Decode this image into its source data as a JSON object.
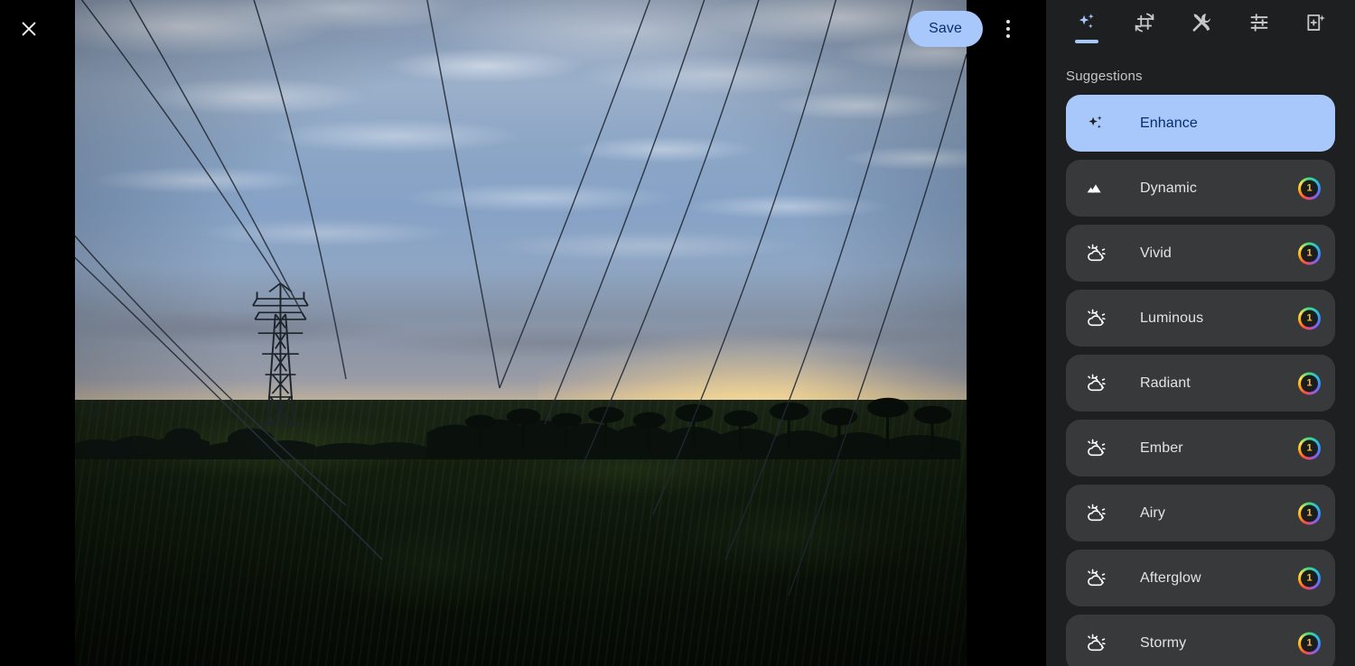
{
  "viewer": {
    "close_icon": "close-icon",
    "save_label": "Save",
    "more_icon": "more-vertical-icon",
    "photo_alt": "Sunset over a green field with an electricity transmission tower, power lines and silhouetted palm trees"
  },
  "panel": {
    "heading": "Suggestions",
    "accent_color": "#a8c7fa",
    "panel_bg": "#1e1f20",
    "card_bg": "#37393b",
    "selected_text_color": "#062e6f",
    "toolbar": [
      {
        "name": "tab-suggestions",
        "icon": "sparkle-icon",
        "label": "Suggestions",
        "active": true
      },
      {
        "name": "tab-crop",
        "icon": "crop-rotate-icon",
        "label": "Crop",
        "active": false
      },
      {
        "name": "tab-tools",
        "icon": "tools-icon",
        "label": "Tools",
        "active": false
      },
      {
        "name": "tab-adjust",
        "icon": "sliders-icon",
        "label": "Adjust",
        "active": false
      },
      {
        "name": "tab-add",
        "icon": "add-effect-icon",
        "label": "Add",
        "active": false
      }
    ],
    "suggestions": [
      {
        "label": "Enhance",
        "icon": "sparkle-icon",
        "selected": true,
        "badge": null
      },
      {
        "label": "Dynamic",
        "icon": "mountain-icon",
        "selected": false,
        "badge": "1"
      },
      {
        "label": "Vivid",
        "icon": "sun-cloud-icon",
        "selected": false,
        "badge": "1"
      },
      {
        "label": "Luminous",
        "icon": "sun-cloud-icon",
        "selected": false,
        "badge": "1"
      },
      {
        "label": "Radiant",
        "icon": "sun-cloud-icon",
        "selected": false,
        "badge": "1"
      },
      {
        "label": "Ember",
        "icon": "sun-cloud-icon",
        "selected": false,
        "badge": "1"
      },
      {
        "label": "Airy",
        "icon": "sun-cloud-icon",
        "selected": false,
        "badge": "1"
      },
      {
        "label": "Afterglow",
        "icon": "sun-cloud-icon",
        "selected": false,
        "badge": "1"
      },
      {
        "label": "Stormy",
        "icon": "sun-cloud-icon",
        "selected": false,
        "badge": "1"
      }
    ]
  }
}
